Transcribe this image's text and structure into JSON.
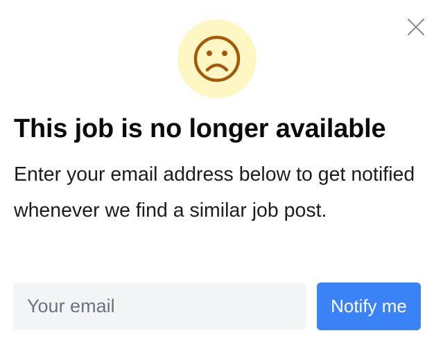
{
  "dialog": {
    "title": "This job is no longer available",
    "description": "Enter your email address below to get notified whenever we find a similar job post.",
    "icon": "sad-face-icon",
    "close_icon": "close-icon"
  },
  "form": {
    "email_placeholder": "Your email",
    "email_value": "",
    "submit_label": "Notify me"
  },
  "colors": {
    "icon_background": "#fef7c3",
    "icon_stroke": "#a55a0b",
    "button_background": "#3b82f6",
    "input_background": "#f3f4f6",
    "close_icon": "#8a9099"
  }
}
